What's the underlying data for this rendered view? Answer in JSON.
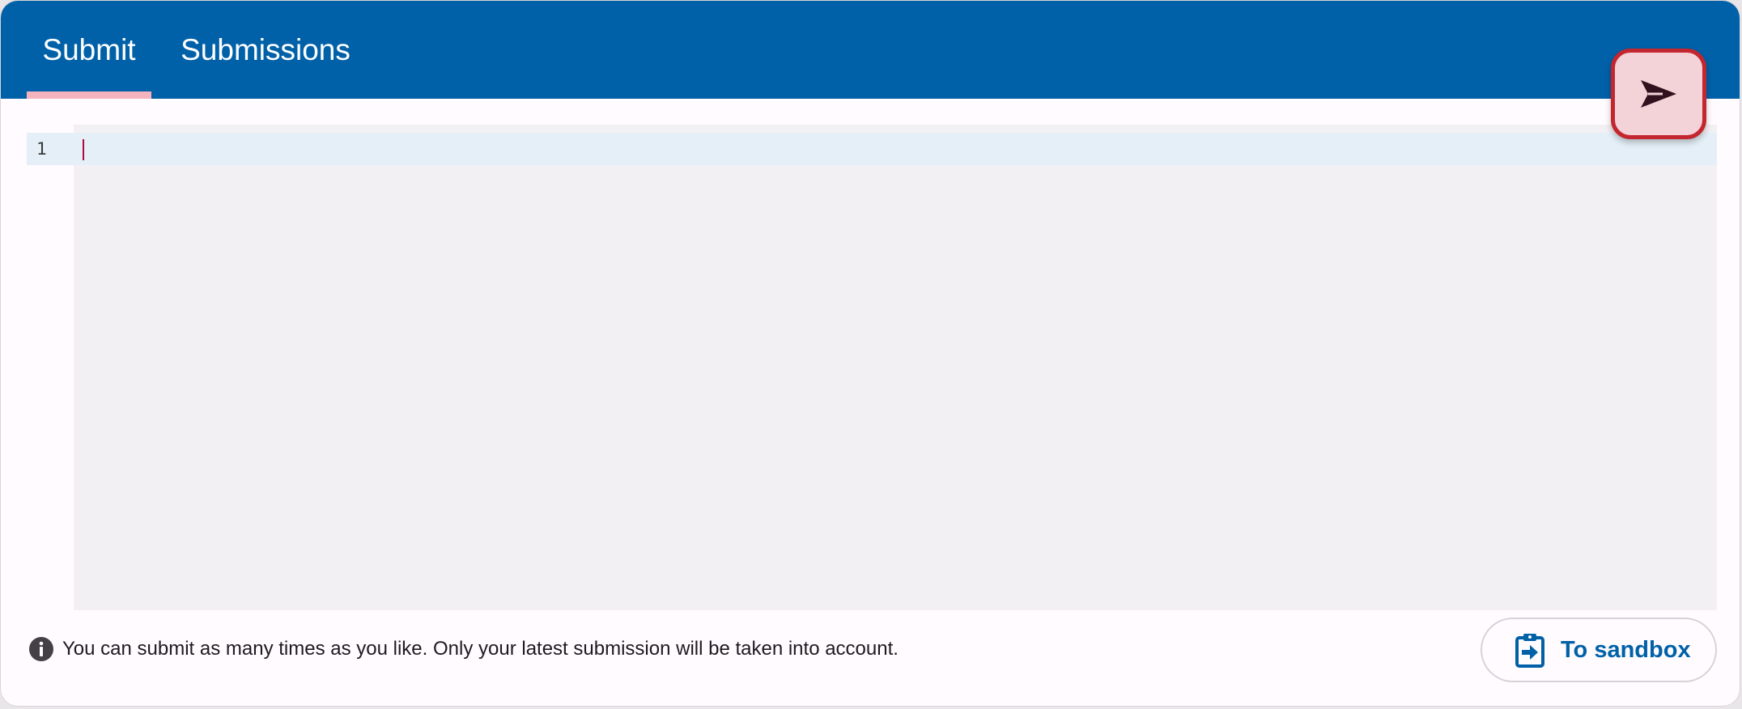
{
  "tabs": [
    {
      "label": "Submit",
      "selected": true
    },
    {
      "label": "Submissions",
      "selected": false
    }
  ],
  "editor": {
    "line_numbers": [
      "1"
    ],
    "content": ""
  },
  "fab": {
    "icon": "send-icon"
  },
  "footer": {
    "info_icon": "info-icon",
    "message": "You can submit as many times as you like. Only your latest submission will be taken into account."
  },
  "sandbox_button": {
    "icon": "clipboard-arrow-icon",
    "label": "To sandbox"
  },
  "colors": {
    "header": "#0061a8",
    "tab_indicator": "#f4b3bd",
    "editor_background": "#f3f0f3",
    "active_line": "#e4eff7",
    "fab_background": "#f3d2d8",
    "fab_border": "#c3262f",
    "accent_text": "#0061a8"
  }
}
